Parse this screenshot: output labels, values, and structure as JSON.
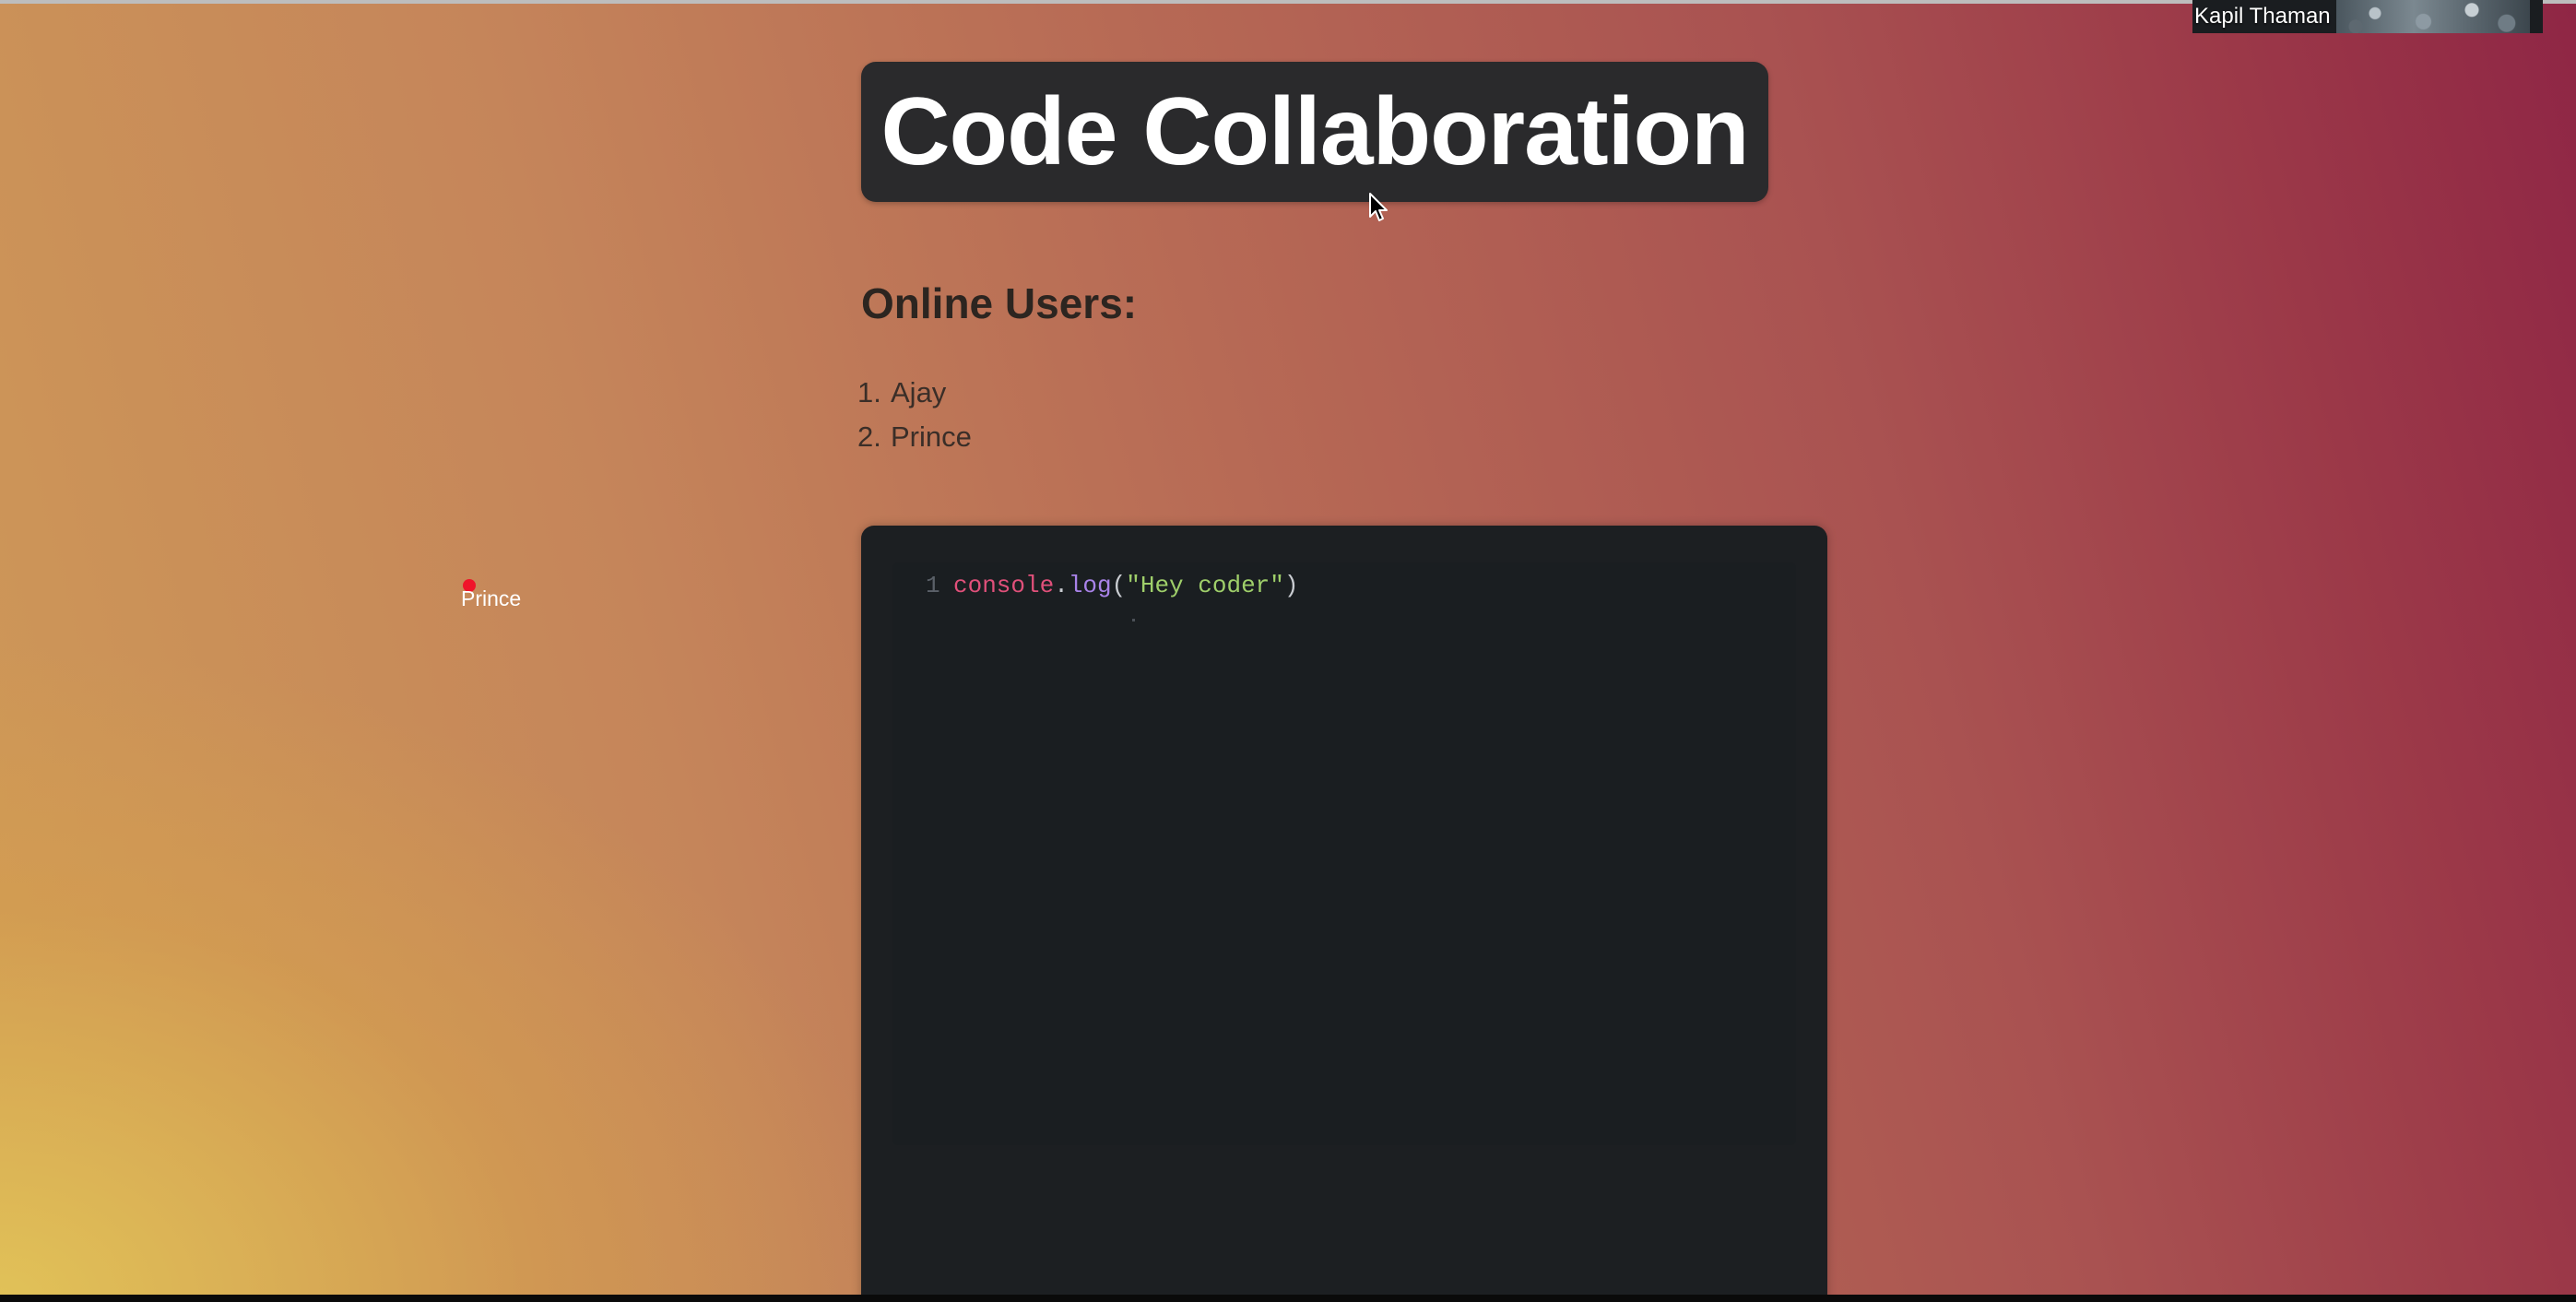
{
  "video_call": {
    "participant_name": "Kapil Thaman"
  },
  "header": {
    "title": "Code Collaboration"
  },
  "online_users": {
    "heading": "Online Users:",
    "users": [
      {
        "number": "1.",
        "name": "Ajay"
      },
      {
        "number": "2.",
        "name": "Prince"
      }
    ]
  },
  "editor": {
    "line_number": "1",
    "tokens": {
      "object": "console",
      "dot": ".",
      "method": "log",
      "open_paren": "(",
      "string": "\"Hey coder\"",
      "close_paren": ")"
    },
    "remote_cursor": {
      "user": "Prince",
      "color": "#f0142a"
    }
  },
  "colors": {
    "gradient_yellow": "#e2c458",
    "gradient_orange": "#c5855a",
    "gradient_magenta": "#8f2645",
    "title_box": "#2a2a2c",
    "editor_bg": "#1c1f22"
  },
  "icons": {
    "mouse_pointer": "arrow-cursor-icon"
  }
}
